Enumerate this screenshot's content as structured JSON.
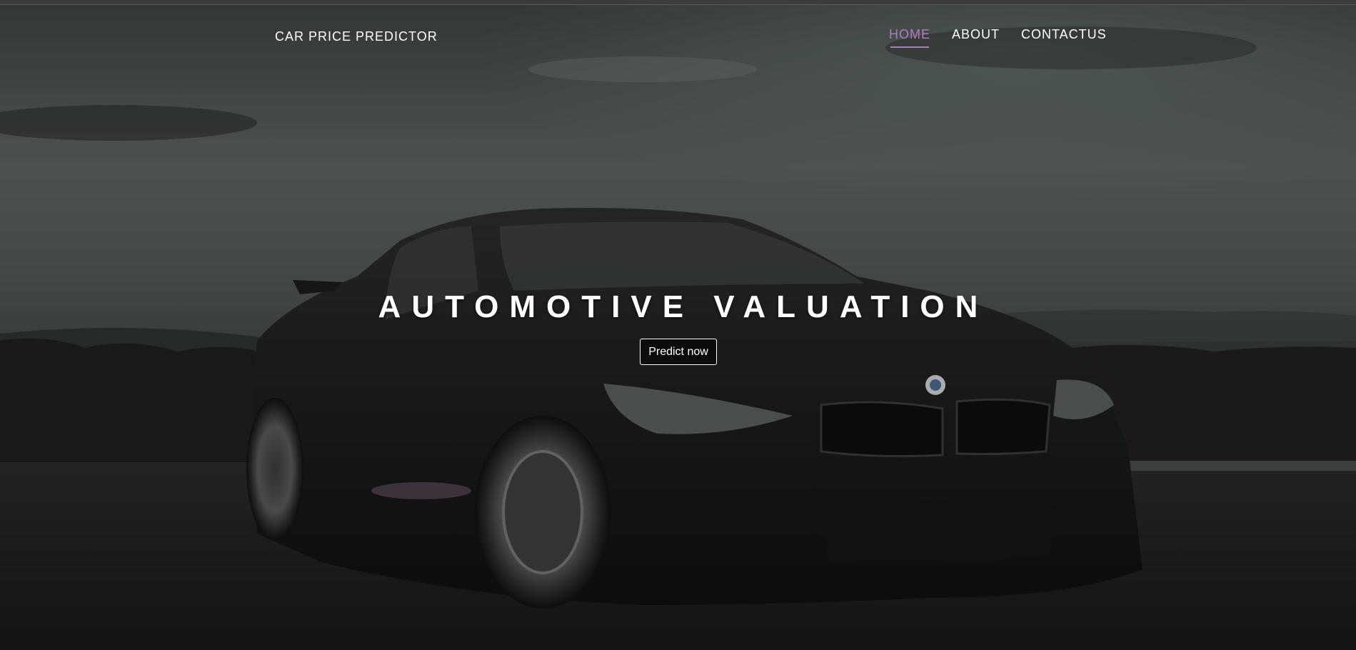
{
  "navbar": {
    "brand": "CAR PRICE PREDICTOR",
    "links": [
      {
        "label": "HOME",
        "active": true
      },
      {
        "label": "ABOUT",
        "active": false
      },
      {
        "label": "CONTACTUS",
        "active": false
      }
    ]
  },
  "hero": {
    "title": "AUTOMOTIVE VALUATION",
    "button_label": "Predict now",
    "background_image": "dark-bmw-m4-coupe-photo"
  },
  "colors": {
    "active_link": "#b07cc0",
    "text": "#ffffff",
    "overlay": "#2a2c2b"
  }
}
